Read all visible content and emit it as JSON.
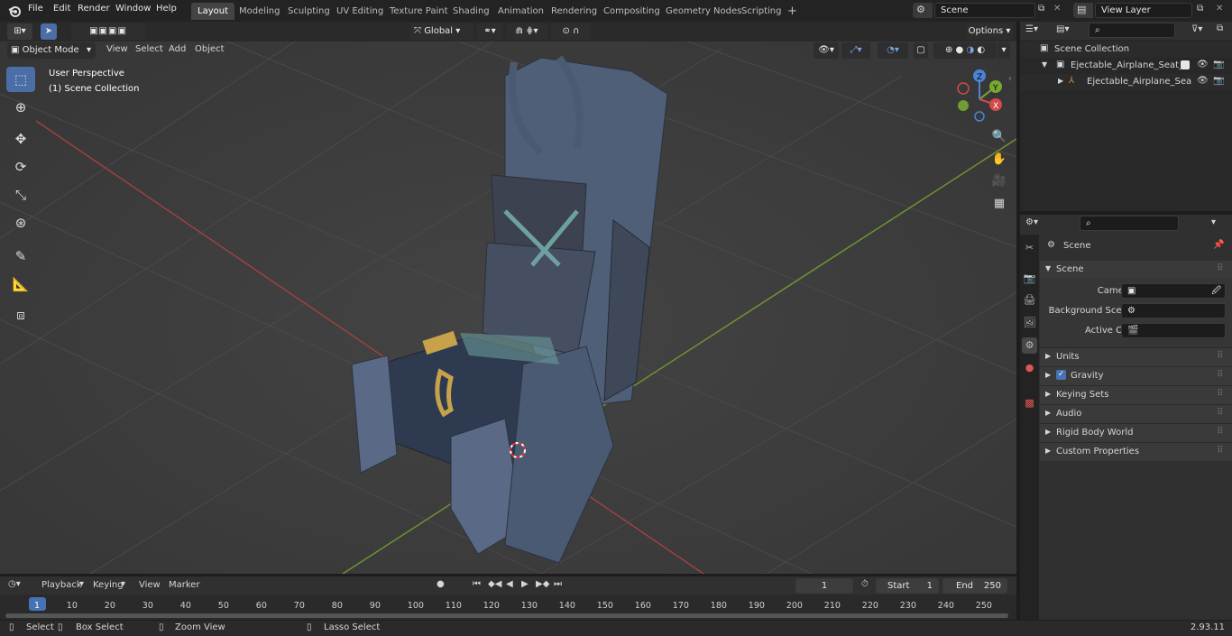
{
  "topbar": {
    "menus": [
      "File",
      "Edit",
      "Render",
      "Window",
      "Help"
    ],
    "workspaces": [
      "Layout",
      "Modeling",
      "Sculpting",
      "UV Editing",
      "Texture Paint",
      "Shading",
      "Animation",
      "Rendering",
      "Compositing",
      "Geometry Nodes",
      "Scripting"
    ],
    "active_workspace": "Layout",
    "add_tab": "+",
    "scene": "Scene",
    "view_layer": "View Layer"
  },
  "viewport": {
    "mode": "Object Mode",
    "menus": [
      "View",
      "Select",
      "Add",
      "Object"
    ],
    "transform_orientation": "Global",
    "options": "Options",
    "overlay_title": "User Perspective",
    "overlay_collection": "(1) Scene Collection",
    "gizmo_axes": {
      "x": "X",
      "y": "Y",
      "z": "Z"
    }
  },
  "outliner": {
    "root": "Scene Collection",
    "items": [
      "Ejectable_Airplane_Seat_ACE",
      "Ejectable_Airplane_Seat_"
    ]
  },
  "properties": {
    "context": "Scene",
    "panel": "Scene",
    "fields": [
      {
        "label": "Camera",
        "value": ""
      },
      {
        "label": "Background Scene",
        "value": ""
      },
      {
        "label": "Active Clip",
        "value": ""
      }
    ],
    "sections": [
      "Units",
      "Gravity",
      "Keying Sets",
      "Audio",
      "Rigid Body World",
      "Custom Properties"
    ],
    "gravity_checked": true
  },
  "timeline": {
    "menus": [
      "Playback",
      "Keying",
      "View",
      "Marker"
    ],
    "current_frame": "1",
    "start_label": "Start",
    "start": "1",
    "end_label": "End",
    "end": "250",
    "ticks": [
      "1",
      "10",
      "20",
      "30",
      "40",
      "50",
      "60",
      "70",
      "80",
      "90",
      "100",
      "110",
      "120",
      "130",
      "140",
      "150",
      "160",
      "170",
      "180",
      "190",
      "200",
      "210",
      "220",
      "230",
      "240",
      "250"
    ]
  },
  "statusbar": {
    "items": [
      "Select",
      "Box Select",
      "Zoom View",
      "Lasso Select"
    ],
    "version": "2.93.11"
  },
  "colors": {
    "accent": "#4772b3",
    "x_axis": "#d24a4a",
    "y_axis": "#77a832",
    "z_axis": "#4a84d6",
    "ui_bg": "#303030"
  }
}
